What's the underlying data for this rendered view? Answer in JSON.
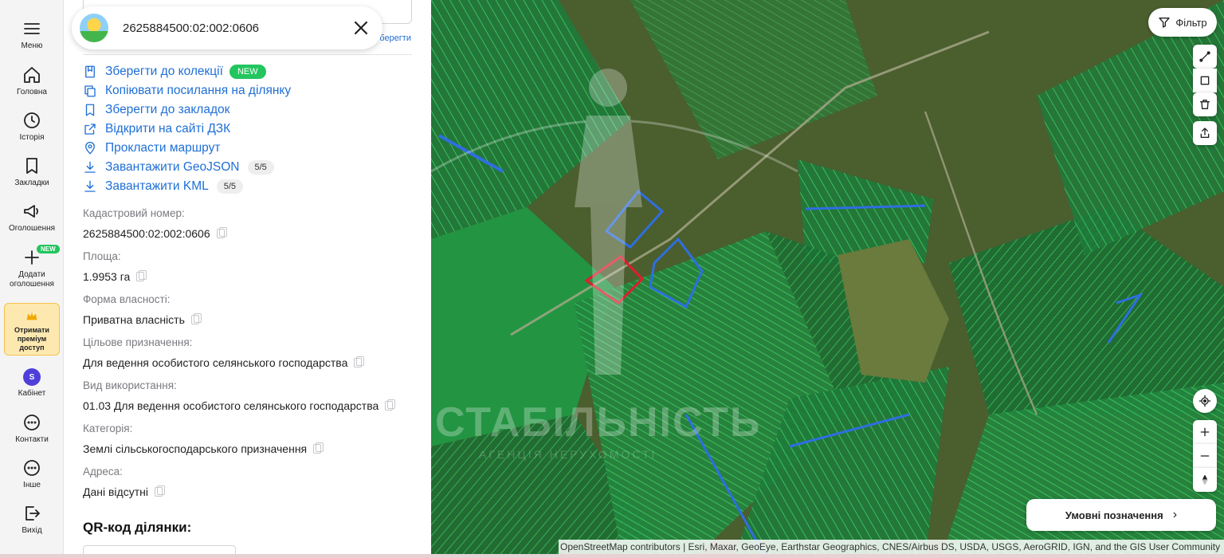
{
  "nav": {
    "menu": "Меню",
    "home": "Головна",
    "history": "Історія",
    "bookmarks": "Закладки",
    "ads": "Оголошення",
    "add_ad": "Додати оголошення",
    "add_ad_badge": "NEW",
    "premium": "Отримати преміум доступ",
    "avatar_letter": "S",
    "cabinet": "Кабінет",
    "contacts": "Контакти",
    "other": "Інше",
    "logout": "Вихід"
  },
  "search": {
    "value": "2625884500:02:002:0606",
    "partial_link": "берегти"
  },
  "actions": [
    {
      "label": "Зберегти до колекції",
      "badge": "NEW",
      "icon": "collection-icon"
    },
    {
      "label": "Копіювати посилання на ділянку",
      "icon": "copy-link-icon"
    },
    {
      "label": "Зберегти до закладок",
      "icon": "bookmark-icon"
    },
    {
      "label": "Відкрити на сайті ДЗК",
      "icon": "external-link-icon"
    },
    {
      "label": "Прокласти маршрут",
      "icon": "location-pin-icon"
    },
    {
      "label": "Завантажити GeoJSON",
      "count": "5/5",
      "icon": "download-icon"
    },
    {
      "label": "Завантажити KML",
      "count": "5/5",
      "icon": "download-icon"
    }
  ],
  "fields": {
    "cadastral": {
      "label": "Кадастровий номер:",
      "value": "2625884500:02:002:0606"
    },
    "area": {
      "label": "Площа:",
      "value": "1.9953 га"
    },
    "ownership": {
      "label": "Форма власності:",
      "value": "Приватна власність"
    },
    "purpose": {
      "label": "Цільове призначення:",
      "value": "Для ведення особистого селянського господарства"
    },
    "usage": {
      "label": "Вид використання:",
      "value": "01.03 Для ведення особистого селянського господарства"
    },
    "category": {
      "label": "Категорія:",
      "value": "Землі сільськогосподарського призначення"
    },
    "address": {
      "label": "Адреса:",
      "value": "Дані відсутні"
    }
  },
  "qr_title": "QR-код ділянки:",
  "map": {
    "filter_label": "Фільтр",
    "legend_label": "Умовні позначення",
    "attribution": "OpenStreetMap contributors | Esri, Maxar, GeoEye, Earthstar Geographics, CNES/Airbus DS, USDA, USGS, AeroGRID, IGN, and the GIS User Community",
    "watermark": "СТАБІЛЬНІСТЬ",
    "watermark_sub": "АГЕНЦІЯ НЕРУХОМОСТІ",
    "colors": {
      "parcel": "#22c55e",
      "selected": "#e11d2e",
      "blue": "#2f6ee0"
    }
  }
}
